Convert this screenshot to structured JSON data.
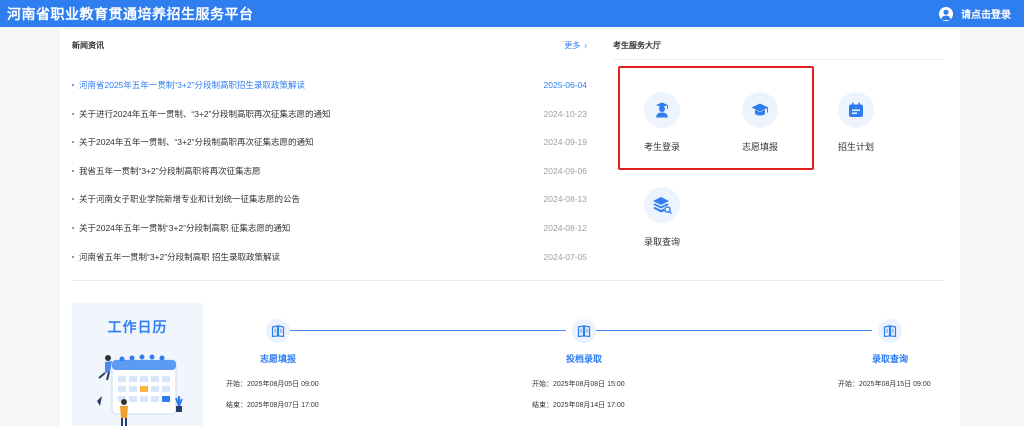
{
  "header": {
    "title": "河南省职业教育贯通培养招生服务平台",
    "login_label": "请点击登录"
  },
  "news": {
    "title": "新闻资讯",
    "more_label": "更多",
    "more_arrow": "›",
    "items": [
      {
        "text": "河南省2025年五年一贯制“3+2”分段制高职招生录取政策解读",
        "date": "2025-06-04"
      },
      {
        "text": "关于进行2024年五年一贯制、“3+2”分段制高职再次征集志愿的通知",
        "date": "2024-10-23"
      },
      {
        "text": "关于2024年五年一贯制、“3+2”分段制高职再次征集志愿的通知",
        "date": "2024-09-19"
      },
      {
        "text": "我省五年一贯制“3+2”分段制高职将再次征集志愿",
        "date": "2024-09-06"
      },
      {
        "text": "关于河南女子职业学院新增专业和计划统一征集志愿的公告",
        "date": "2024-08-13"
      },
      {
        "text": "关于2024年五年一贯制“3+2”分段制高职 征集志愿的通知",
        "date": "2024-08-12"
      },
      {
        "text": "河南省五年一贯制“3+2”分段制高职 招生录取政策解读",
        "date": "2024-07-05"
      }
    ]
  },
  "services": {
    "title": "考生服务大厅",
    "items": [
      {
        "label": "考生登录",
        "icon": "student-icon"
      },
      {
        "label": "志愿填报",
        "icon": "graduation-cap-icon"
      },
      {
        "label": "招生计划",
        "icon": "calendar-icon"
      },
      {
        "label": "录取查询",
        "icon": "layers-search-icon"
      }
    ]
  },
  "calendar": {
    "title": "工作日历"
  },
  "timeline": [
    {
      "name": "志愿填报",
      "start": "开始：2025年08月05日 09:00",
      "end": "结束：2025年08月07日 17:00",
      "icon": "book-icon"
    },
    {
      "name": "投档录取",
      "start": "开始：2025年08月08日 15:00",
      "end": "结束：2025年08月14日 17:00",
      "icon": "book-icon"
    },
    {
      "name": "录取查询",
      "start": "开始：2025年08月15日 09:00",
      "end": "",
      "icon": "book-icon"
    }
  ],
  "colors": {
    "primary": "#2f7ef0",
    "highlight_box": "#e02020"
  }
}
